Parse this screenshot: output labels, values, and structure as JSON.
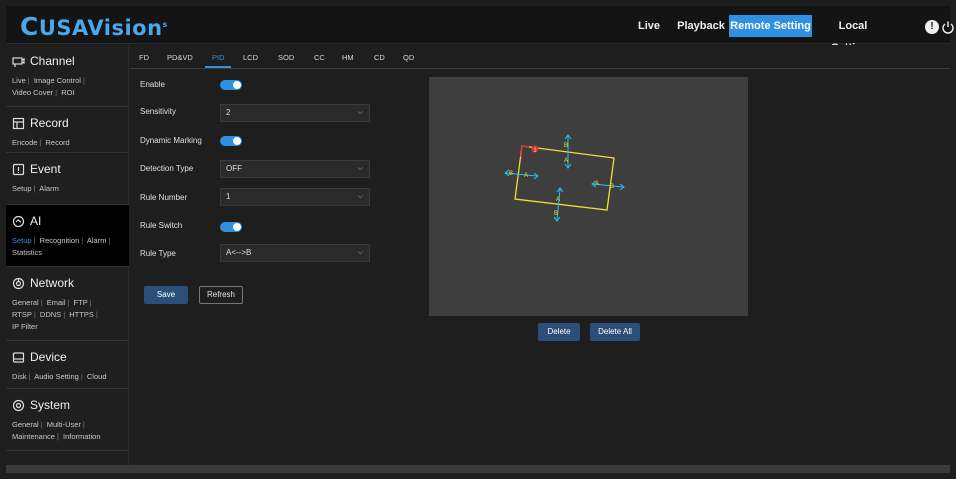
{
  "header": {
    "logo": "USAVision",
    "nav": [
      {
        "label": "Live"
      },
      {
        "label": "Playback"
      },
      {
        "label": "Remote Setting",
        "active": true
      },
      {
        "label": "Local Settings"
      }
    ],
    "icons": [
      "info-icon",
      "power-icon"
    ]
  },
  "sidebar": {
    "sections": [
      {
        "title": "Channel",
        "icon": "camera-icon",
        "links": [
          "Live",
          "Image Control",
          "Video Cover",
          "ROI"
        ]
      },
      {
        "title": "Record",
        "icon": "record-icon",
        "links": [
          "Encode",
          "Record"
        ]
      },
      {
        "title": "Event",
        "icon": "event-icon",
        "links": [
          "Setup",
          "Alarm"
        ]
      },
      {
        "title": "AI",
        "icon": "ai-icon",
        "active": true,
        "active_link": "Setup",
        "links": [
          "Setup",
          "Recognition",
          "Alarm",
          "Statistics"
        ]
      },
      {
        "title": "Network",
        "icon": "network-icon",
        "links": [
          "General",
          "Email",
          "FTP",
          "RTSP",
          "DDNS",
          "HTTPS",
          "IP Filter"
        ]
      },
      {
        "title": "Device",
        "icon": "device-icon",
        "links": [
          "Disk",
          "Audio Setting",
          "Cloud"
        ]
      },
      {
        "title": "System",
        "icon": "gear-icon",
        "links": [
          "General",
          "Multi-User",
          "Maintenance",
          "Information"
        ]
      }
    ]
  },
  "tabs": [
    "FD",
    "PD&VD",
    "PID",
    "LCD",
    "SOD",
    "CC",
    "HM",
    "CD",
    "QD"
  ],
  "active_tab": "PID",
  "form": {
    "enable_label": "Enable",
    "enable_value": true,
    "sensitivity_label": "Sensitivity",
    "sensitivity_value": "2",
    "dynamic_marking_label": "Dynamic Marking",
    "dynamic_marking_value": true,
    "detection_type_label": "Detection Type",
    "detection_type_value": "OFF",
    "rule_number_label": "Rule Number",
    "rule_number_value": "1",
    "rule_switch_label": "Rule Switch",
    "rule_switch_value": true,
    "rule_type_label": "Rule Type",
    "rule_type_value": "A<-->B"
  },
  "buttons": {
    "save": "Save",
    "refresh": "Refresh",
    "delete": "Delete",
    "delete_all": "Delete All"
  },
  "preview": {
    "rule_id": "1",
    "side_label_a": "A",
    "side_label_b": "B",
    "colors": {
      "box": "#f0e030",
      "arrow": "#21c8e8",
      "marker": "#e03030",
      "background": "#3e3e3e"
    }
  },
  "colors": {
    "accent": "#2f8fe0",
    "button": "#2c4f7a",
    "logo": "#4aa7ea"
  }
}
